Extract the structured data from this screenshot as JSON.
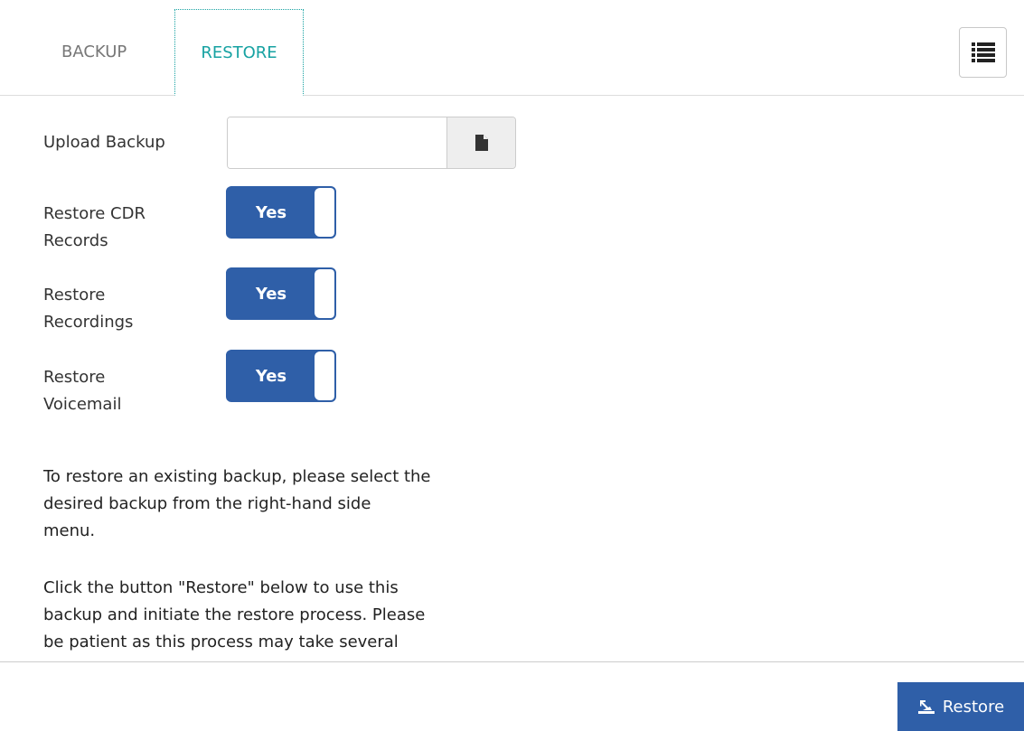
{
  "tabs": [
    {
      "label": "BACKUP",
      "active": false
    },
    {
      "label": "RESTORE",
      "active": true
    }
  ],
  "menu_button": {
    "icon": "list-icon"
  },
  "form": {
    "upload": {
      "label": "Upload Backup",
      "value": "",
      "icon": "file-icon"
    },
    "restore_cdr": {
      "label_line1": "Restore CDR",
      "label_line2": "Records",
      "toggle": "Yes"
    },
    "restore_recordings": {
      "label_line1": "Restore",
      "label_line2": "Recordings",
      "toggle": "Yes"
    },
    "restore_voicemail": {
      "label_line1": "Restore",
      "label_line2": "Voicemail",
      "toggle": "Yes"
    }
  },
  "info": {
    "para1_line1": "To restore an existing backup, please select the",
    "para1_line2": "desired backup from the right-hand side",
    "para1_line3": "menu.",
    "para2_line1": "Click the button \"Restore\" below to use this",
    "para2_line2": "backup and initiate the restore process. Please",
    "para2_line3": "be patient as this process may take several"
  },
  "footer": {
    "restore_button": {
      "label": "Restore",
      "icon": "restore-icon"
    }
  },
  "colors": {
    "accent": "#2f5fa8",
    "active_tab": "#17a2a2"
  }
}
